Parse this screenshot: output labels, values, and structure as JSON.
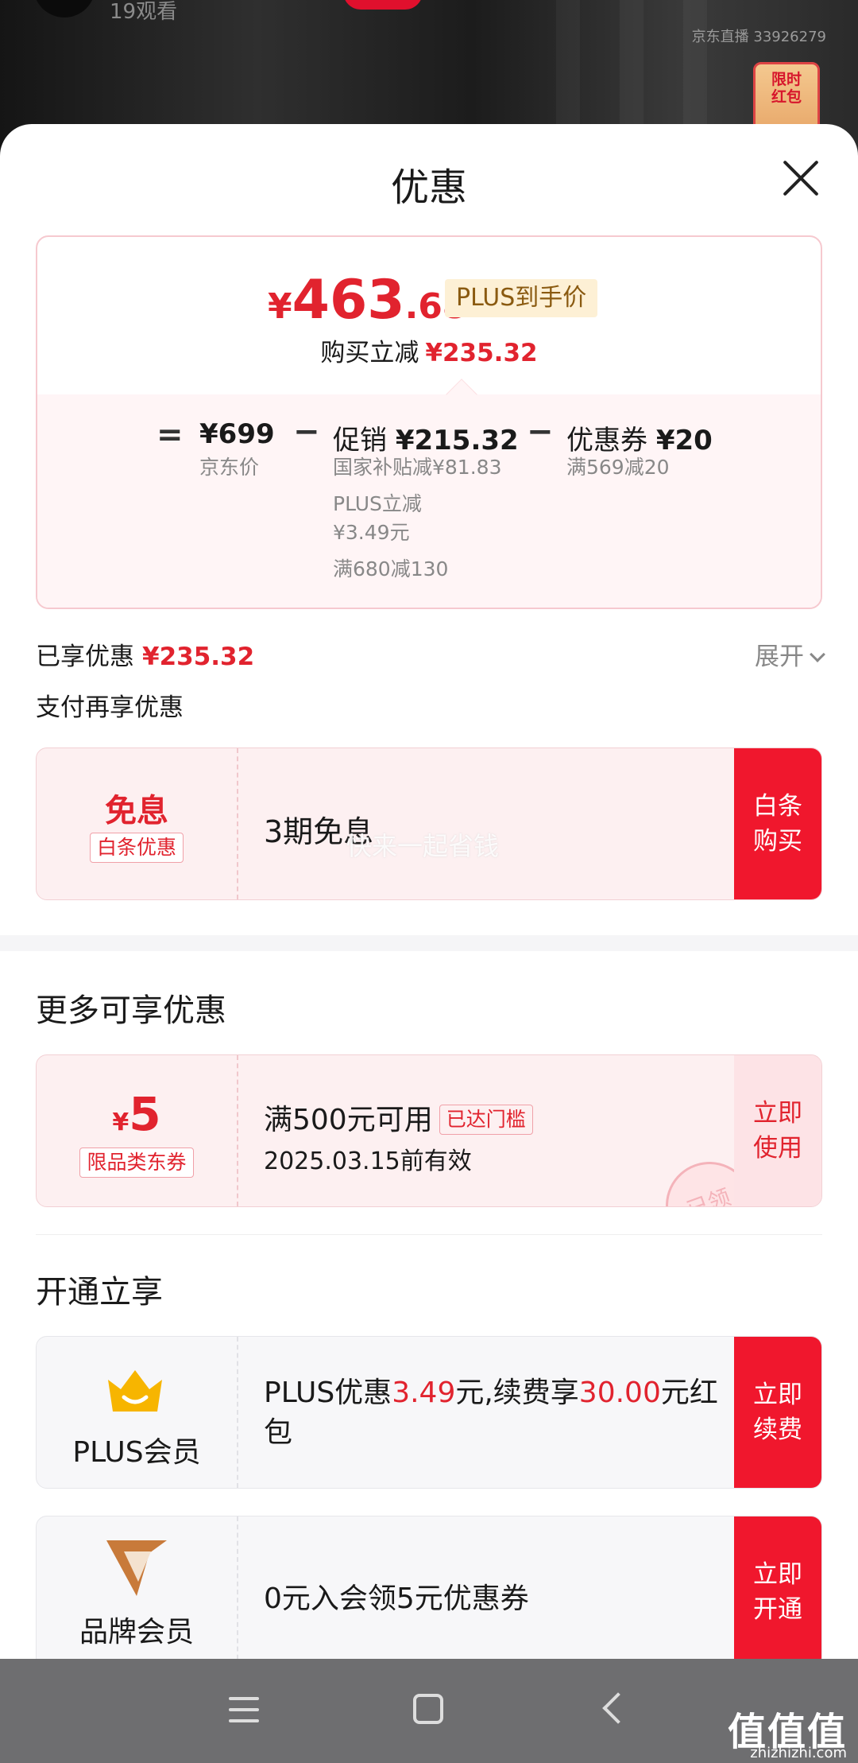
{
  "live": {
    "viewers": "19观看",
    "room_id": "京东直播 33926279",
    "redpacket": "限时\n红包"
  },
  "sheet": {
    "title": "优惠"
  },
  "price_card": {
    "final_price_yen": "¥",
    "final_price_int": "463",
    "final_price_dec": ".68",
    "plus_tag": "PLUS到手价",
    "reduce_label": "购买立减",
    "reduce_amount": "¥235.32",
    "op_equal": "=",
    "op_minus": "−",
    "jd_price": "¥699",
    "jd_price_label": "京东价",
    "promo_label": "促销",
    "promo_amount": "¥215.32",
    "promo_sub_1": "国家补贴减¥81.83",
    "promo_sub_2": "PLUS立减",
    "promo_sub_3": "¥3.49元",
    "promo_sub_4": "满680减130",
    "coupon_label": "优惠券",
    "coupon_amount": "¥20",
    "coupon_sub": "满569减20"
  },
  "enjoyed": {
    "label": "已享优惠",
    "amount": "¥235.32",
    "expand_label": "展开"
  },
  "pay_section": {
    "title": "支付再享优惠",
    "offer": {
      "big": "免息",
      "tag": "白条优惠",
      "text": "3期免息",
      "watermark": "快来一起省钱",
      "action": "白条\n购买"
    }
  },
  "more_section": {
    "title": "更多可享优惠",
    "coupon": {
      "yen": "¥",
      "value": "5",
      "tag": "限品类东券",
      "line1": "满500元可用",
      "reach_tag": "已达门槛",
      "line2": "2025.03.15前有效",
      "stamp": "已领",
      "action": "立即\n使用"
    }
  },
  "open_section": {
    "title": "开通立享",
    "plus": {
      "label": "PLUS会员",
      "text_a": "PLUS优惠",
      "text_b": "3.49",
      "text_c": "元,续费享",
      "text_d": "30.00",
      "text_e": "元红包",
      "action": "立即\n续费",
      "icon": "crown-icon"
    },
    "brand": {
      "label": "品牌会员",
      "text": "0元入会领5元优惠券",
      "action": "立即\n开通",
      "icon": "brand-v-icon"
    }
  },
  "watermark_site": {
    "logo": "值值值",
    "url": "zhizhizhi.com"
  },
  "colors": {
    "accent_red": "#e1232e",
    "button_red": "#f0172d",
    "gold": "#f7b500"
  }
}
